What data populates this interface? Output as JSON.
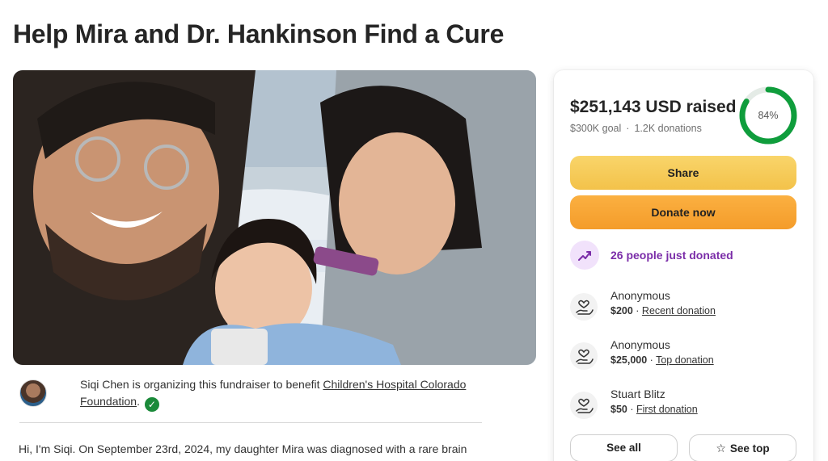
{
  "page": {
    "title": "Help Mira and Dr. Hankinson Find a Cure"
  },
  "organizer": {
    "text_before": "Siqi Chen is organizing this fundraiser to benefit ",
    "beneficiary": "Children's Hospital Colorado Foundation",
    "text_after": ".",
    "verified_icon": "check-circle-icon"
  },
  "story": {
    "first_line": "Hi, I'm Siqi. On September 23rd, 2024, my daughter Mira was diagnosed with a rare brain"
  },
  "progress": {
    "raised_label": "$251,143 USD raised",
    "goal": "$300K goal",
    "separator": "·",
    "donations": "1.2K donations",
    "percent_label": "84%",
    "percent_value": 0.84,
    "ring_color": "#0f9d3c"
  },
  "buttons": {
    "share": "Share",
    "donate": "Donate now",
    "see_all": "See all",
    "see_top": "See top"
  },
  "activity": {
    "just_donated": "26 people just donated",
    "accent_color": "#7a2ca8"
  },
  "donations": [
    {
      "name": "Anonymous",
      "amount": "$200",
      "sep": " · ",
      "tag": "Recent donation"
    },
    {
      "name": "Anonymous",
      "amount": "$25,000",
      "sep": " · ",
      "tag": "Top donation"
    },
    {
      "name": "Stuart Blitz",
      "amount": "$50",
      "sep": " · ",
      "tag": "First donation"
    }
  ]
}
